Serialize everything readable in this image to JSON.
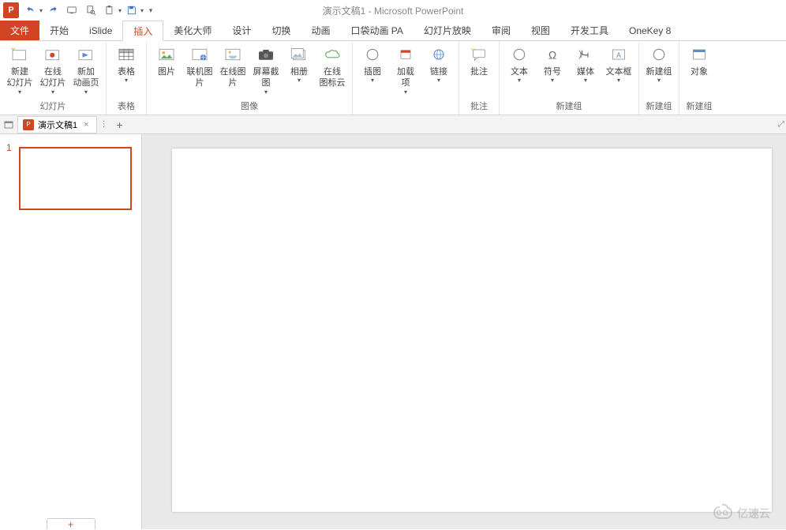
{
  "app": {
    "title": "演示文稿1 - Microsoft PowerPoint",
    "logo": "P"
  },
  "qat": {
    "undo": "↶",
    "redo": "↻",
    "start": "▢",
    "preview": "🔍",
    "paste": "📋",
    "save": "💾"
  },
  "tabs": {
    "file": "文件",
    "home": "开始",
    "islide": "iSlide",
    "insert": "插入",
    "beautify": "美化大师",
    "design": "设计",
    "transition": "切换",
    "animation": "动画",
    "pocket": "口袋动画 PA",
    "slideshow": "幻灯片放映",
    "review": "审阅",
    "view": "视图",
    "dev": "开发工具",
    "onekey": "OneKey 8"
  },
  "ribbon": {
    "groups": {
      "slides": {
        "label": "幻灯片",
        "new_slide": "新建\n幻灯片",
        "online_slide": "在线\n幻灯片",
        "new_anim": "新加\n动画页"
      },
      "table": {
        "label": "表格",
        "table": "表格"
      },
      "image": {
        "label": "图像",
        "picture": "图片",
        "online_pic": "联机图片",
        "web_pic": "在线图片",
        "screenshot": "屏幕截图",
        "album": "相册",
        "icon_cloud": "在线\n图标云"
      },
      "illus": {
        "insert_chart": "插图",
        "addin": "加载\n项",
        "link": "链接"
      },
      "annot": {
        "label": "批注",
        "annot": "批注"
      },
      "newgrp1": {
        "label": "新建组",
        "text": "文本",
        "symbol": "符号",
        "media": "媒体",
        "textbox": "文本框"
      },
      "newgrp2": {
        "label": "新建组",
        "newgrp": "新建组"
      },
      "newgrp3": {
        "label": "新建组",
        "object": "对象"
      }
    }
  },
  "doc": {
    "name": "演示文稿1",
    "slide_num": "1",
    "close": "×",
    "add": "+",
    "menu": "⋮"
  },
  "watermark": "亿速云"
}
